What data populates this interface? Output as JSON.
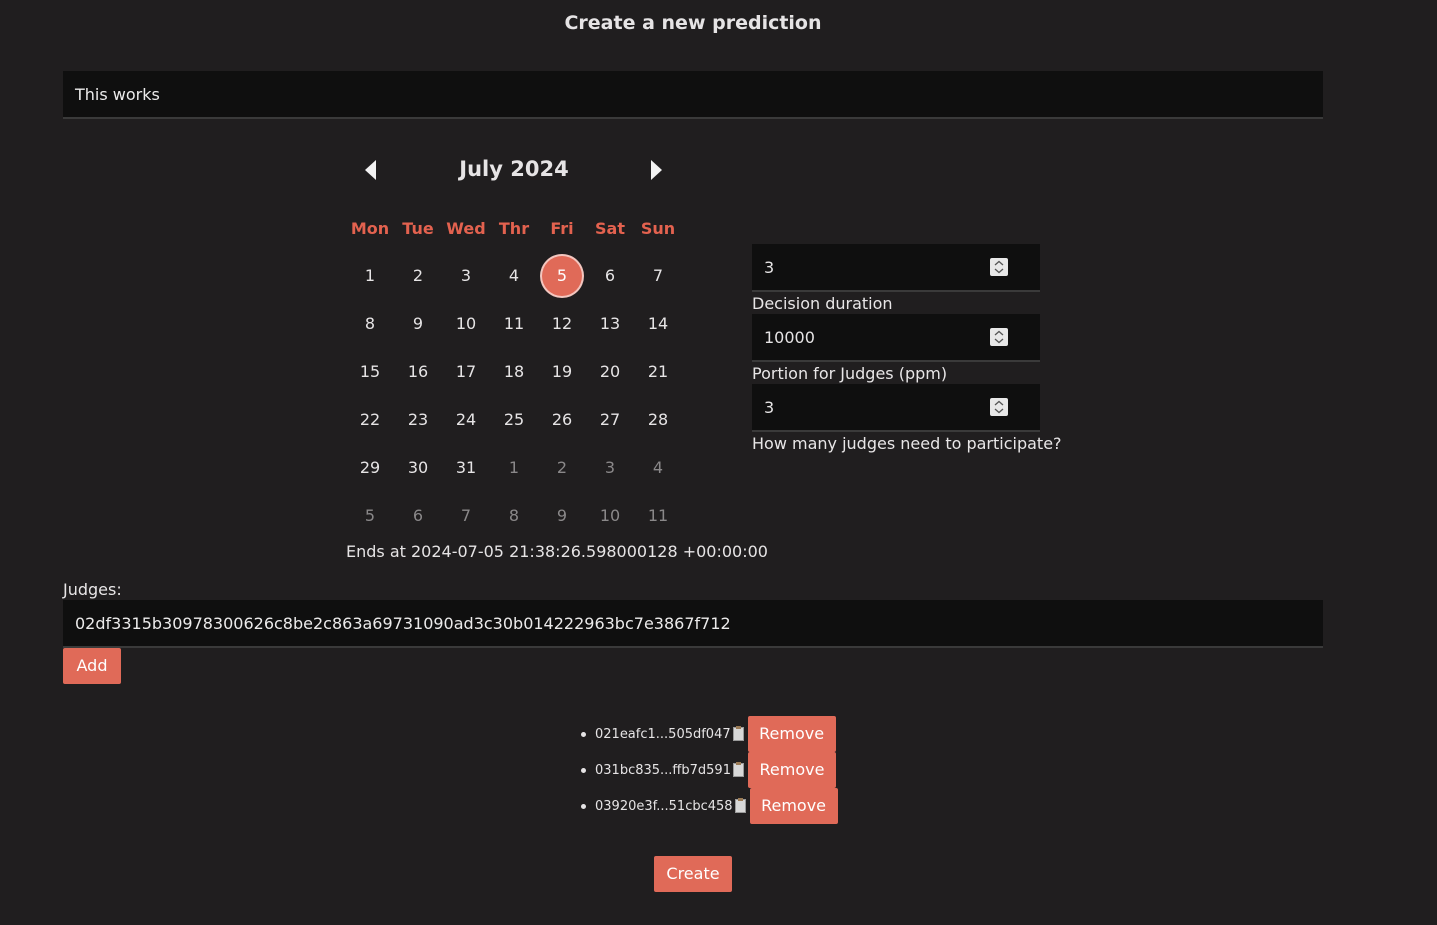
{
  "page": {
    "title": "Create a new prediction"
  },
  "prediction_input": {
    "value": "This works"
  },
  "calendar": {
    "month_label": "July 2024",
    "weekdays": [
      "Mon",
      "Tue",
      "Wed",
      "Thr",
      "Fri",
      "Sat",
      "Sun"
    ],
    "weeks": [
      [
        {
          "d": "1"
        },
        {
          "d": "2"
        },
        {
          "d": "3"
        },
        {
          "d": "4"
        },
        {
          "d": "5",
          "selected": true
        },
        {
          "d": "6"
        },
        {
          "d": "7"
        }
      ],
      [
        {
          "d": "8"
        },
        {
          "d": "9"
        },
        {
          "d": "10"
        },
        {
          "d": "11"
        },
        {
          "d": "12"
        },
        {
          "d": "13"
        },
        {
          "d": "14"
        }
      ],
      [
        {
          "d": "15"
        },
        {
          "d": "16"
        },
        {
          "d": "17"
        },
        {
          "d": "18"
        },
        {
          "d": "19"
        },
        {
          "d": "20"
        },
        {
          "d": "21"
        }
      ],
      [
        {
          "d": "22"
        },
        {
          "d": "23"
        },
        {
          "d": "24"
        },
        {
          "d": "25"
        },
        {
          "d": "26"
        },
        {
          "d": "27"
        },
        {
          "d": "28"
        }
      ],
      [
        {
          "d": "29"
        },
        {
          "d": "30"
        },
        {
          "d": "31"
        },
        {
          "d": "1",
          "muted": true
        },
        {
          "d": "2",
          "muted": true
        },
        {
          "d": "3",
          "muted": true
        },
        {
          "d": "4",
          "muted": true
        }
      ],
      [
        {
          "d": "5",
          "muted": true
        },
        {
          "d": "6",
          "muted": true
        },
        {
          "d": "7",
          "muted": true
        },
        {
          "d": "8",
          "muted": true
        },
        {
          "d": "9",
          "muted": true
        },
        {
          "d": "10",
          "muted": true
        },
        {
          "d": "11",
          "muted": true
        }
      ]
    ],
    "ends_at": "Ends at 2024-07-05 21:38:26.598000128 +00:00:00"
  },
  "settings": {
    "decision_duration": {
      "value": "3",
      "label": "Decision duration"
    },
    "judge_portion": {
      "value": "10000",
      "label": "Portion for Judges (ppm)"
    },
    "judge_count": {
      "value": "3",
      "label": "How many judges need to participate?"
    }
  },
  "judges": {
    "label": "Judges:",
    "input_value": "02df3315b30978300626c8be2c863a69731090ad3c30b014222963bc7e3867f712",
    "add_label": "Add",
    "list": [
      {
        "key": "021eafc1...505df047",
        "remove_label": "Remove"
      },
      {
        "key": "031bc835...ffb7d591",
        "remove_label": "Remove"
      },
      {
        "key": "03920e3f...51cbc458",
        "remove_label": "Remove"
      }
    ]
  },
  "create_label": "Create",
  "colors": {
    "accent": "#e06a58",
    "background": "#201e1f",
    "input": "#0f0f0f"
  },
  "icons": {
    "prev": "triangle-left-icon",
    "next": "triangle-right-icon",
    "copy": "clipboard-icon"
  }
}
